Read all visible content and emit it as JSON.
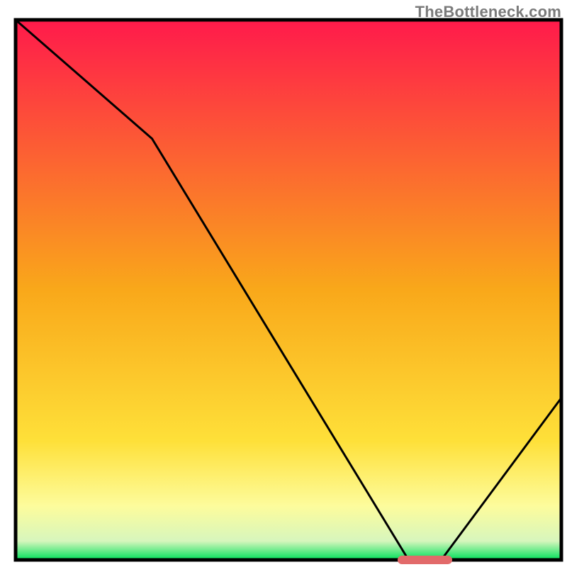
{
  "watermark": "TheBottleneck.com",
  "chart_data": {
    "type": "line",
    "title": "",
    "xlabel": "",
    "ylabel": "",
    "xlim": [
      0,
      100
    ],
    "ylim": [
      0,
      100
    ],
    "x": [
      0,
      25,
      72,
      78,
      100
    ],
    "values": [
      100,
      78,
      0,
      0,
      30
    ],
    "marker": {
      "x_start": 70,
      "x_end": 80,
      "y": 0
    },
    "gradient_stops": [
      {
        "offset": 0.0,
        "color": "#ff1a4b"
      },
      {
        "offset": 0.5,
        "color": "#f9a81a"
      },
      {
        "offset": 0.78,
        "color": "#fee039"
      },
      {
        "offset": 0.9,
        "color": "#fdfc9c"
      },
      {
        "offset": 0.965,
        "color": "#d7f6bd"
      },
      {
        "offset": 1.0,
        "color": "#00e05a"
      }
    ],
    "border_color": "#000000",
    "line_color": "#000000",
    "marker_color": "#e26a6a"
  }
}
